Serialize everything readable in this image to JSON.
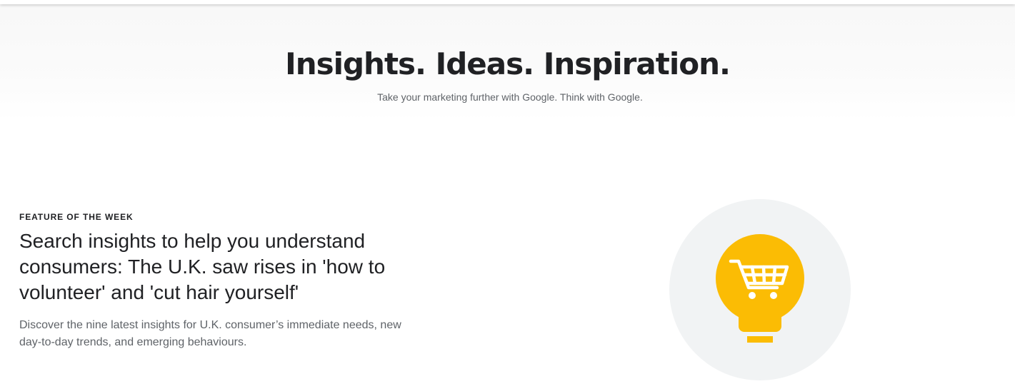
{
  "hero": {
    "title": "Insights. Ideas. Inspiration.",
    "subtitle": "Take your marketing further with Google. Think with Google."
  },
  "feature": {
    "eyebrow": "FEATURE OF THE WEEK",
    "title": "Search insights to help you understand consumers: The U.K. saw rises in 'how to volunteer' and 'cut hair yourself'",
    "description": "Discover the nine latest insights for U.K. consumer’s immediate needs, new day-to-day trends, and emerging behaviours.",
    "illustration": {
      "icon": "lightbulb-shopping-cart-icon",
      "circle_color": "#f1f3f4",
      "bulb_color": "#fbbc04",
      "cart_color": "#ffffff"
    }
  },
  "colors": {
    "text_primary": "#202124",
    "text_secondary": "#5f6368",
    "hero_background": "#f8f8f8"
  }
}
